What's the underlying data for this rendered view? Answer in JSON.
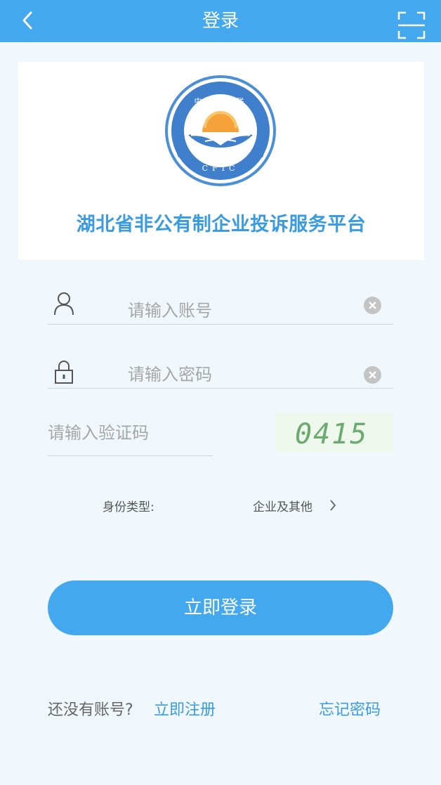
{
  "header": {
    "title": "登录",
    "back_icon": "chevron-left-icon",
    "scan_icon": "scan-frame-icon",
    "color": "#44a8ee"
  },
  "brand": {
    "emblem_top_text": "中国工商联",
    "emblem_bottom_text": "CFIC",
    "platform_name": "湖北省非公有制企业投诉服务平台",
    "accent": "#3a9be0"
  },
  "form": {
    "account": {
      "placeholder": "请输入账号",
      "value": "",
      "icon": "user-icon"
    },
    "password": {
      "placeholder": "请输入密码",
      "value": "",
      "icon": "lock-icon"
    },
    "captcha": {
      "placeholder": "请输入验证码",
      "value": "",
      "code": "0415"
    },
    "identity": {
      "label": "身份类型:",
      "value": "企业及其他"
    },
    "submit_label": "立即登录"
  },
  "footer": {
    "no_account_text": "还没有账号?",
    "register_label": "立即注册",
    "forgot_label": "忘记密码"
  }
}
